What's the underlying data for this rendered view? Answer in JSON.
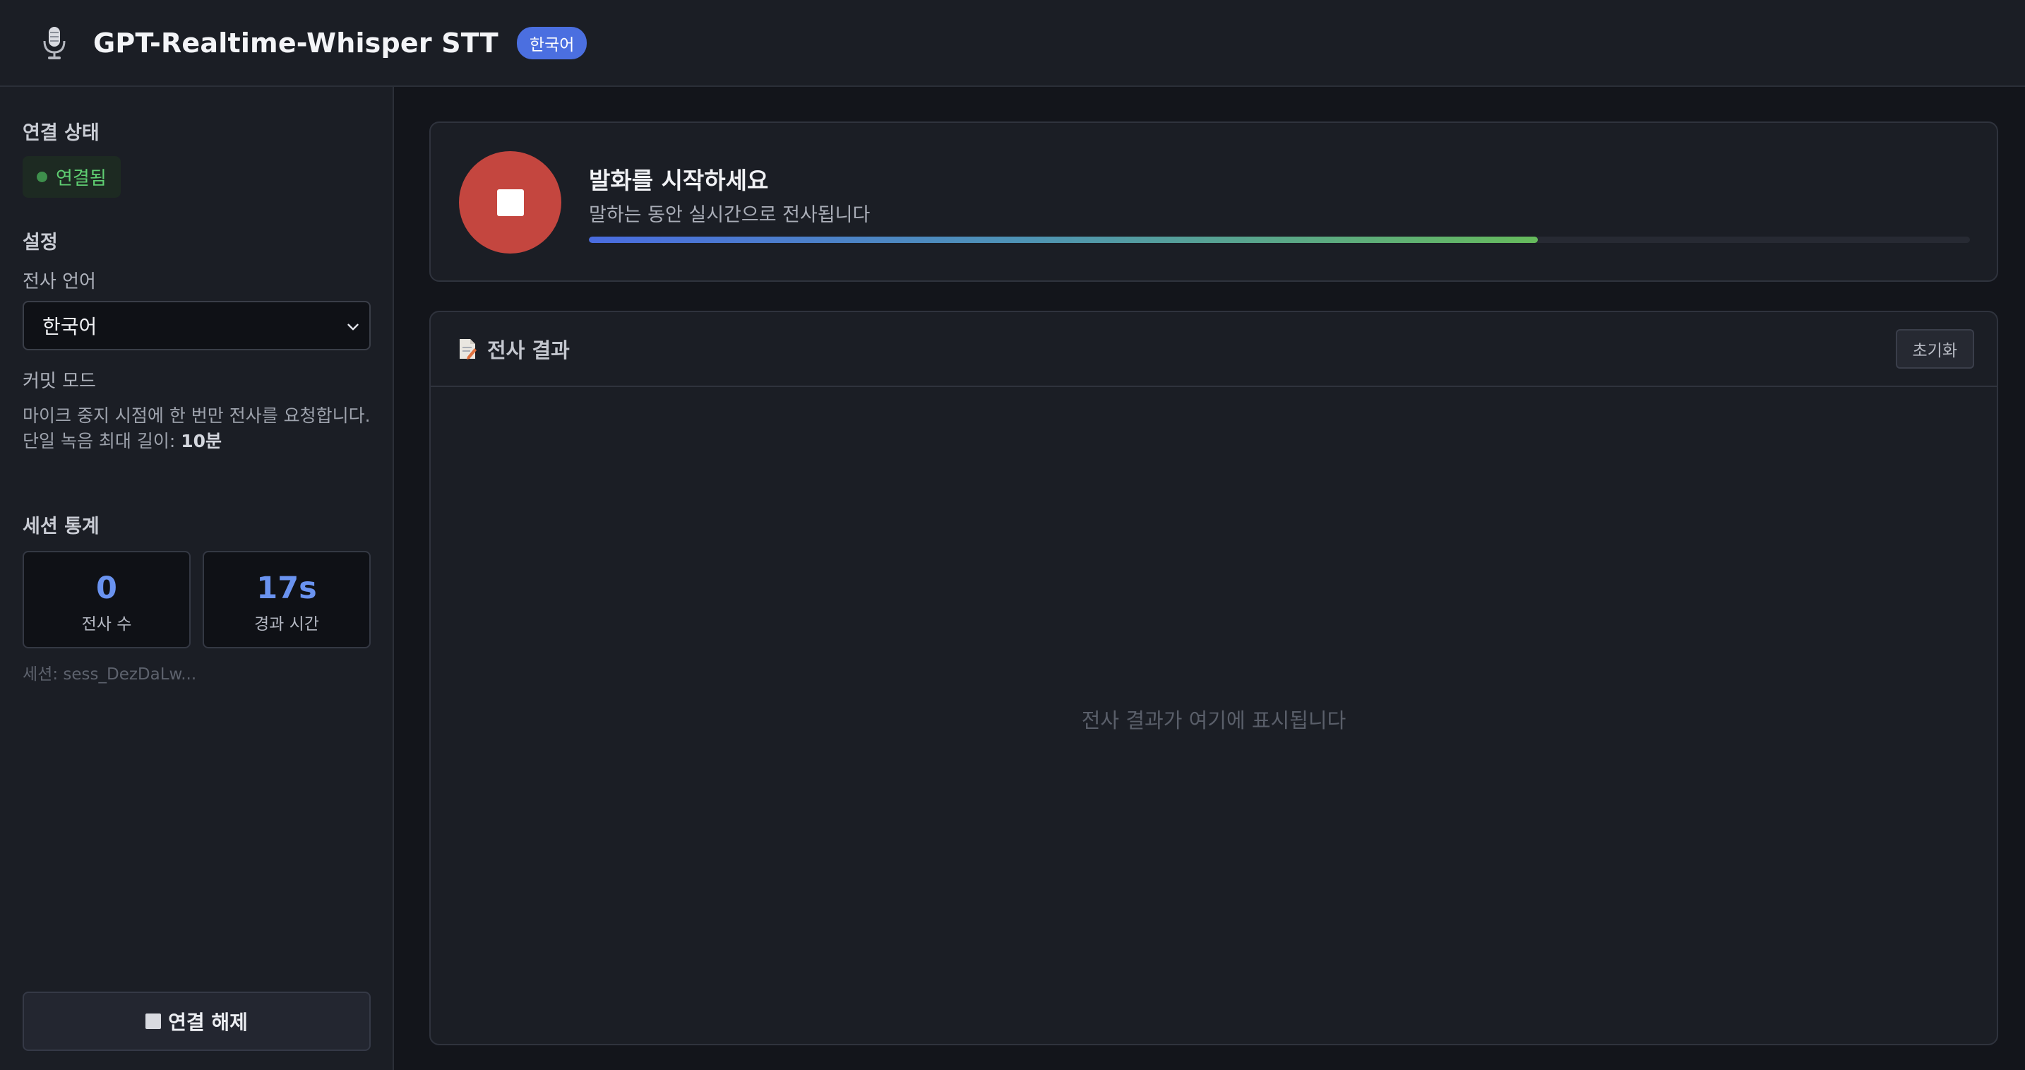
{
  "header": {
    "title": "GPT-Realtime-Whisper STT",
    "language_badge": "한국어",
    "icon": "microphone-icon"
  },
  "sidebar": {
    "connection": {
      "title": "연결 상태",
      "status_text": "연결됨",
      "status_color": "#5fce72"
    },
    "settings": {
      "title": "설정",
      "language_label": "전사 언어",
      "language_value": "한국어",
      "commit_mode_label": "커밋 모드",
      "commit_mode_desc": "마이크 중지 시점에 한 번만 전사를 요청합니다.",
      "max_length_label": "단일 녹음 최대 길이: ",
      "max_length_value": "10분"
    },
    "stats": {
      "title": "세션 통계",
      "transcripts_value": "0",
      "transcripts_label": "전사 수",
      "elapsed_value": "17s",
      "elapsed_label": "경과 시간",
      "session_id": "세션: sess_DezDaLw..."
    },
    "disconnect_label": "연결 해제"
  },
  "main": {
    "record": {
      "title": "발화를 시작하세요",
      "subtitle": "말하는 동안 실시간으로 전사됩니다",
      "progress": 0.687,
      "button_color": "#c4463f"
    },
    "result": {
      "title": "전사 결과",
      "reset_label": "초기화",
      "empty_message": "전사 결과가 여기에 표시됩니다"
    }
  },
  "colors": {
    "accent": "#4b6fe0",
    "stat_value": "#6a93f0",
    "background": "#13151b",
    "panel": "#1b1e25"
  }
}
